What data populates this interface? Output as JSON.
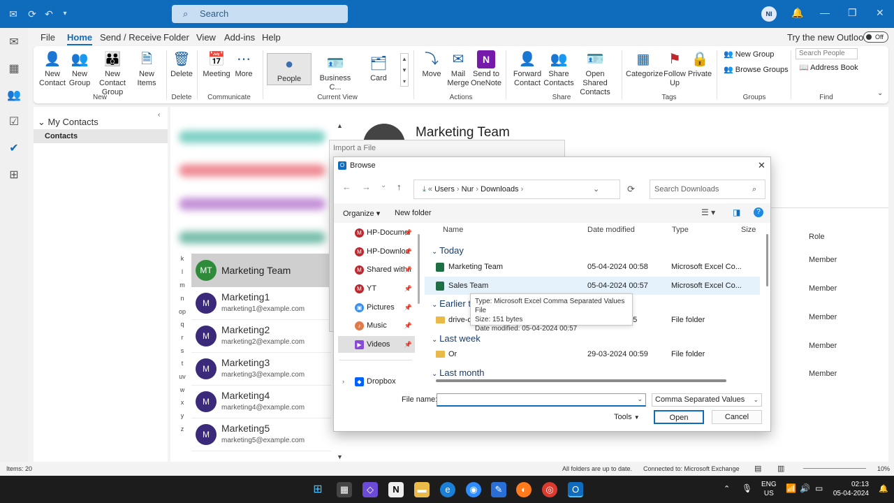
{
  "titlebar": {
    "search_placeholder": "Search",
    "user_initials": "NI"
  },
  "menubar": {
    "items": [
      "File",
      "Home",
      "Send / Receive",
      "Folder",
      "View",
      "Add-ins",
      "Help"
    ],
    "active": "Home",
    "try_new": "Try the new Outlook",
    "toggle": "Off"
  },
  "ribbon": {
    "new_contact": "New\nContact",
    "new_group": "New\nGroup",
    "new_contact_group": "New Contact\nGroup",
    "new_items": "New\nItems",
    "delete": "Delete",
    "meeting": "Meeting",
    "more": "More",
    "people": "People",
    "business_card": "Business C...",
    "card": "Card",
    "move": "Move",
    "mail_merge": "Mail\nMerge",
    "send_onenote": "Send to\nOneNote",
    "forward_contact": "Forward\nContact",
    "share_contacts": "Share\nContacts",
    "open_shared": "Open Shared\nContacts",
    "categorize": "Categorize",
    "follow_up": "Follow\nUp",
    "private": "Private",
    "new_group_small": "New Group",
    "browse_groups": "Browse Groups",
    "search_people": "Search People",
    "address_book": "Address Book",
    "groups": {
      "new": "New",
      "delete": "Delete",
      "communicate": "Communicate",
      "current_view": "Current View",
      "actions": "Actions",
      "share": "Share",
      "tags": "Tags",
      "groups": "Groups",
      "find": "Find"
    }
  },
  "folders": {
    "header": "My Contacts",
    "selected": "Contacts"
  },
  "contacts": {
    "selected": {
      "initials": "MT",
      "name": "Marketing Team"
    },
    "items": [
      {
        "initial": "M",
        "name": "Marketing1",
        "email": "marketing1@example.com"
      },
      {
        "initial": "M",
        "name": "Marketing2",
        "email": "marketing2@example.com"
      },
      {
        "initial": "M",
        "name": "Marketing3",
        "email": "marketing3@example.com"
      },
      {
        "initial": "M",
        "name": "Marketing4",
        "email": "marketing4@example.com"
      },
      {
        "initial": "M",
        "name": "Marketing5",
        "email": "marketing5@example.com"
      }
    ],
    "alpha": [
      "k",
      "l",
      "m",
      "n",
      "op",
      "q",
      "r",
      "s",
      "t",
      "uv",
      "w",
      "x",
      "y",
      "z"
    ]
  },
  "detail": {
    "title": "Marketing Team",
    "role_header": "Role",
    "roles": [
      "Member",
      "Member",
      "Member",
      "Member",
      "Member"
    ]
  },
  "import_dialog": {
    "title": "Import a File"
  },
  "browse": {
    "title": "Browse",
    "path": [
      "Users",
      "Nur",
      "Downloads"
    ],
    "search_placeholder": "Search Downloads",
    "organize": "Organize",
    "new_folder": "New folder",
    "nav_items": [
      "HP-Documer",
      "HP-Downloa",
      "Shared with I",
      "YT",
      "Pictures",
      "Music",
      "Videos",
      "Dropbox"
    ],
    "columns": {
      "name": "Name",
      "date": "Date modified",
      "type": "Type",
      "size": "Size"
    },
    "groups": {
      "today": "Today",
      "earlier": "Earlier th",
      "last_week": "Last week",
      "last_month": "Last month"
    },
    "files": [
      {
        "name": "Marketing Team",
        "date": "05-04-2024 00:58",
        "type": "Microsoft Excel Co..."
      },
      {
        "name": "Sales Team",
        "date": "05-04-2024 00:57",
        "type": "Microsoft Excel Co..."
      },
      {
        "name": "drive-c",
        "date": "05",
        "type": "File folder"
      },
      {
        "name": "Or",
        "date": "29-03-2024 00:59",
        "type": "File folder"
      }
    ],
    "tooltip": {
      "type": "Type: Microsoft Excel Comma Separated Values File",
      "size": "Size: 151 bytes",
      "date": "Date modified: 05-04-2024 00:57"
    },
    "file_name_label": "File name:",
    "file_type": "Comma Separated Values",
    "tools": "Tools",
    "open": "Open",
    "cancel": "Cancel"
  },
  "status": {
    "items": "Items: 20",
    "sync": "All folders are up to date.",
    "connected": "Connected to: Microsoft Exchange",
    "zoom": "10%"
  },
  "taskbar": {
    "lang1": "ENG",
    "lang2": "US",
    "time": "02:13",
    "date": "05-04-2024"
  }
}
